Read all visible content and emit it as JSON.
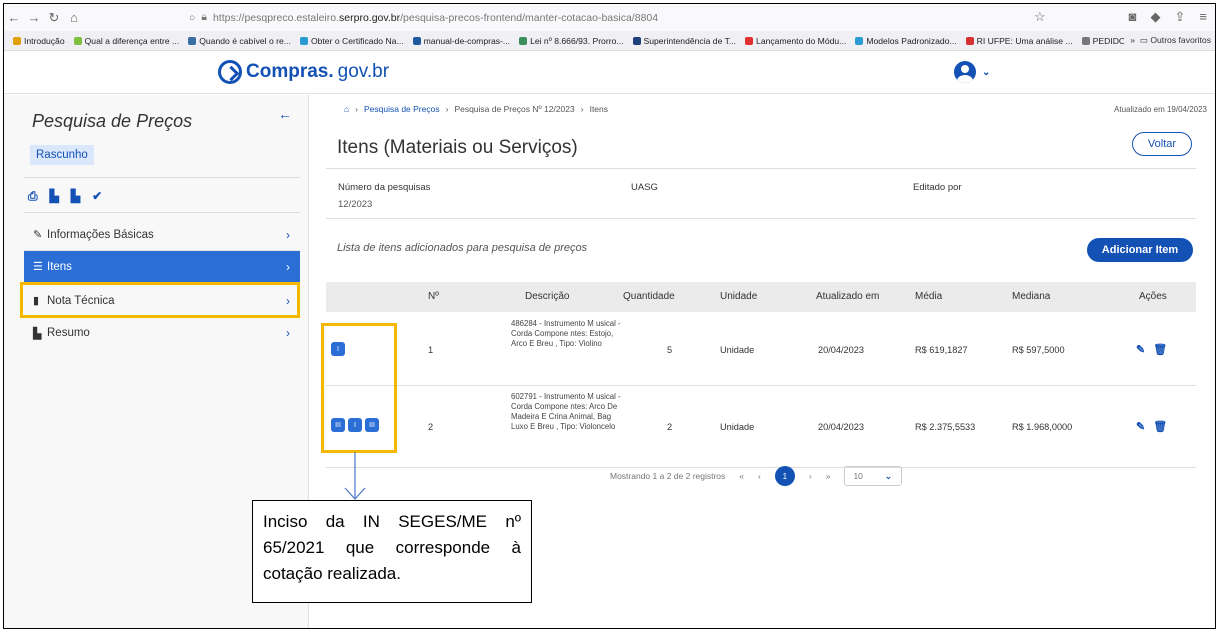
{
  "browser": {
    "url_prefix": "https://pesqpreco.estaleiro.",
    "url_domain": "serpro.gov.br",
    "url_path": "/pesquisa-precos-frontend/manter-cotacao-basica/8804",
    "bookmarks": [
      {
        "label": "Introdução",
        "color": "#e0a000"
      },
      {
        "label": "Qual a diferença entre ...",
        "color": "#7fbf3f"
      },
      {
        "label": "Quando é cabível o re...",
        "color": "#3a6ea5"
      },
      {
        "label": "Obter o Certificado Na...",
        "color": "#2b9bd6"
      },
      {
        "label": "manual-de-compras-...",
        "color": "#1d5a9e"
      },
      {
        "label": "Lei nº 8.666/93. Prorro...",
        "color": "#3c8f5a"
      },
      {
        "label": "Superintendência de T...",
        "color": "#1d3f7a"
      },
      {
        "label": "Lançamento do Módu...",
        "color": "#e03030"
      },
      {
        "label": "Modelos Padronizado...",
        "color": "#2b9bd6"
      },
      {
        "label": "RI UFPE: Uma análise ...",
        "color": "#d63030"
      },
      {
        "label": "PEDIDO DE RESCISÃO ...",
        "color": "#777777"
      }
    ],
    "other_bookmarks": "Outros favoritos"
  },
  "header": {
    "logo_main": "Compras.",
    "logo_gov": "gov.br"
  },
  "sidebar": {
    "title": "Pesquisa de Preços",
    "status_badge": "Rascunho",
    "items": [
      {
        "label": "Informações Básicas",
        "icon": "pencil-icon"
      },
      {
        "label": "Itens",
        "icon": "list-icon"
      },
      {
        "label": "Nota Técnica",
        "icon": "file-icon"
      },
      {
        "label": "Resumo",
        "icon": "file-export-icon"
      }
    ]
  },
  "main": {
    "breadcrumb": {
      "home_icon": "home-icon",
      "level1": "Pesquisa de Preços",
      "level2": "Pesquisa de Preços Nº 12/2023",
      "level3": "Itens"
    },
    "updated_text": "Atualizado em 19/04/2023",
    "title": "Itens (Materiais ou Serviços)",
    "back_button": "Voltar",
    "info": {
      "numero_label": "Número da pesquisas",
      "numero_value": "12/2023",
      "uasg_label": "UASG",
      "editado_label": "Editado por"
    },
    "list_caption": "Lista de itens adicionados para pesquisa de preços",
    "add_button": "Adicionar Item",
    "table": {
      "headers": [
        "Nº",
        "Descrição",
        "Quantidade",
        "Unidade",
        "Atualizado em",
        "Média",
        "Mediana",
        "Ações"
      ],
      "rows": [
        {
          "incisos": [
            "I"
          ],
          "num": "1",
          "desc": "486284 - Instrumento M usical - Corda Compone ntes: Estojo, Arco E Breu , Tipo: Violino",
          "quantidade": "5",
          "unidade": "Unidade",
          "atualizado": "20/04/2023",
          "media": "R$ 619,1827",
          "mediana": "R$ 597,5000"
        },
        {
          "incisos": [
            "III",
            "I",
            "III"
          ],
          "num": "2",
          "desc": "602791 - Instrumento M usical - Corda Compone ntes: Arco De Madeira E Crina Animal, Bag Luxo E Breu , Tipo: Violoncelo",
          "quantidade": "2",
          "unidade": "Unidade",
          "atualizado": "20/04/2023",
          "media": "R$ 2.375,5533",
          "mediana": "R$ 1.968,0000"
        }
      ]
    },
    "pagination": {
      "summary": "Mostrando 1 a 2 de 2 registros",
      "current_page": "1",
      "page_size": "10"
    }
  },
  "annotation": {
    "callout_text": "Inciso da IN SEGES/ME nº 65/2021 que corresponde à cotação realizada.",
    "highlight_color": "#f5b800"
  }
}
